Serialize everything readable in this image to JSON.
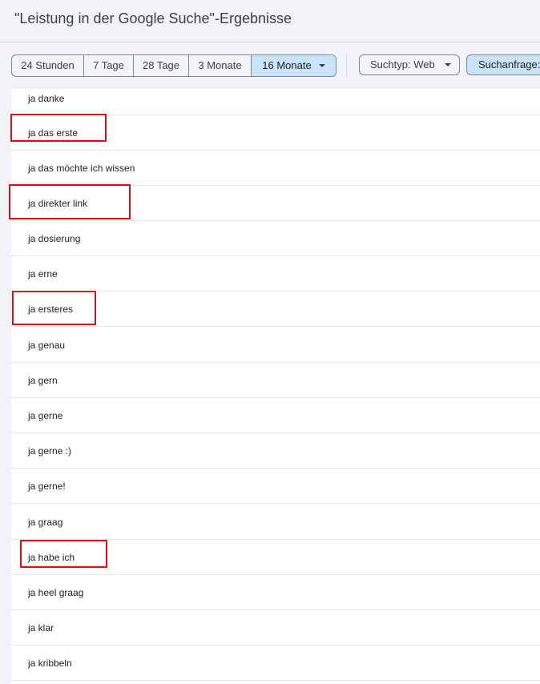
{
  "header": {
    "title": "\"Leistung in der Google Suche\"-Ergebnisse"
  },
  "toolbar": {
    "date_ranges": [
      {
        "label": "24 Stunden",
        "selected": false
      },
      {
        "label": "7 Tage",
        "selected": false
      },
      {
        "label": "28 Tage",
        "selected": false
      },
      {
        "label": "3 Monate",
        "selected": false
      },
      {
        "label": "16 Monate",
        "selected": true
      }
    ],
    "search_type_label": "Suchtyp: Web",
    "query_filter_label": "Suchanfrage:"
  },
  "queries": [
    {
      "label": "ja danke",
      "highlighted": false
    },
    {
      "label": "ja das erste",
      "highlighted": true
    },
    {
      "label": "ja das möchte ich wissen",
      "highlighted": false
    },
    {
      "label": "ja direkter link",
      "highlighted": true
    },
    {
      "label": "ja dosierung",
      "highlighted": false
    },
    {
      "label": "ja erne",
      "highlighted": false
    },
    {
      "label": "ja ersteres",
      "highlighted": true
    },
    {
      "label": "ja genau",
      "highlighted": false
    },
    {
      "label": "ja gern",
      "highlighted": false
    },
    {
      "label": "ja gerne",
      "highlighted": false
    },
    {
      "label": "ja gerne :)",
      "highlighted": false
    },
    {
      "label": "ja gerne!",
      "highlighted": false
    },
    {
      "label": "ja graag",
      "highlighted": false
    },
    {
      "label": "ja habe ich",
      "highlighted": true
    },
    {
      "label": "ja heel graag",
      "highlighted": false
    },
    {
      "label": "ja klar",
      "highlighted": false
    },
    {
      "label": "ja kribbeln",
      "highlighted": false
    }
  ],
  "colors": {
    "selected_chip": "#c9e4fa",
    "highlight_box": "#d0121b"
  }
}
